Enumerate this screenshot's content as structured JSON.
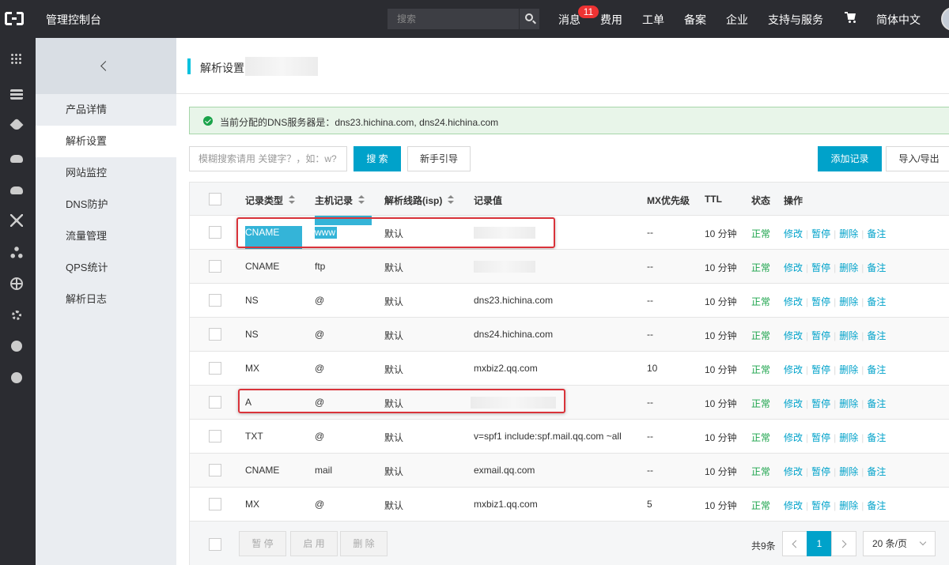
{
  "topbar": {
    "console_title": "管理控制台",
    "search_placeholder": "搜索",
    "nav": [
      "消息",
      "费用",
      "工单",
      "备案",
      "企业",
      "支持与服务",
      "简体中文"
    ],
    "message_badge": "11"
  },
  "rail_icons": [
    "grid-icon",
    "server-icon",
    "heart-icon",
    "cloud-icon",
    "cloud-upload-icon",
    "network-icon",
    "tree-icon",
    "globe-icon",
    "gear-icon",
    "circle-icon",
    "circle-icon"
  ],
  "subnav": {
    "items": [
      "产品详情",
      "解析设置",
      "网站监控",
      "DNS防护",
      "流量管理",
      "QPS统计",
      "解析日志"
    ],
    "active_index": 1
  },
  "page": {
    "title": "解析设置",
    "notice": "当前分配的DNS服务器是：dns23.hichina.com, dns24.hichina.com",
    "keyword_placeholder": "模糊搜索请用 关键字？，如：w?",
    "search_button": "搜 索",
    "guide_button": "新手引导",
    "add_record_button": "添加记录",
    "import_export_button": "导入/导出"
  },
  "table": {
    "headers": [
      "记录类型",
      "主机记录",
      "解析线路(isp)",
      "记录值",
      "MX优先级",
      "TTL",
      "状态",
      "操作"
    ],
    "ops": [
      "修改",
      "暂停",
      "删除",
      "备注"
    ],
    "rows": [
      {
        "type": "CNAME",
        "host": "www",
        "line": "默认",
        "value": "",
        "mx": "--",
        "ttl": "10 分钟",
        "status": "正常"
      },
      {
        "type": "CNAME",
        "host": "ftp",
        "line": "默认",
        "value": "",
        "mx": "--",
        "ttl": "10 分钟",
        "status": "正常"
      },
      {
        "type": "NS",
        "host": "@",
        "line": "默认",
        "value": "dns23.hichina.com",
        "mx": "--",
        "ttl": "10 分钟",
        "status": "正常"
      },
      {
        "type": "NS",
        "host": "@",
        "line": "默认",
        "value": "dns24.hichina.com",
        "mx": "--",
        "ttl": "10 分钟",
        "status": "正常"
      },
      {
        "type": "MX",
        "host": "@",
        "line": "默认",
        "value": "mxbiz2.qq.com",
        "mx": "10",
        "ttl": "10 分钟",
        "status": "正常"
      },
      {
        "type": "A",
        "host": "@",
        "line": "默认",
        "value": "",
        "mx": "--",
        "ttl": "10 分钟",
        "status": "正常"
      },
      {
        "type": "TXT",
        "host": "@",
        "line": "默认",
        "value": "v=spf1 include:spf.mail.qq.com ~all",
        "mx": "--",
        "ttl": "10 分钟",
        "status": "正常"
      },
      {
        "type": "CNAME",
        "host": "mail",
        "line": "默认",
        "value": "exmail.qq.com",
        "mx": "--",
        "ttl": "10 分钟",
        "status": "正常"
      },
      {
        "type": "MX",
        "host": "@",
        "line": "默认",
        "value": "mxbiz1.qq.com",
        "mx": "5",
        "ttl": "10 分钟",
        "status": "正常"
      }
    ]
  },
  "footer": {
    "pause_button": "暂 停",
    "enable_button": "启 用",
    "delete_button": "删 除",
    "total": "共9条",
    "current_page": "1",
    "page_size": "20 条/页"
  }
}
